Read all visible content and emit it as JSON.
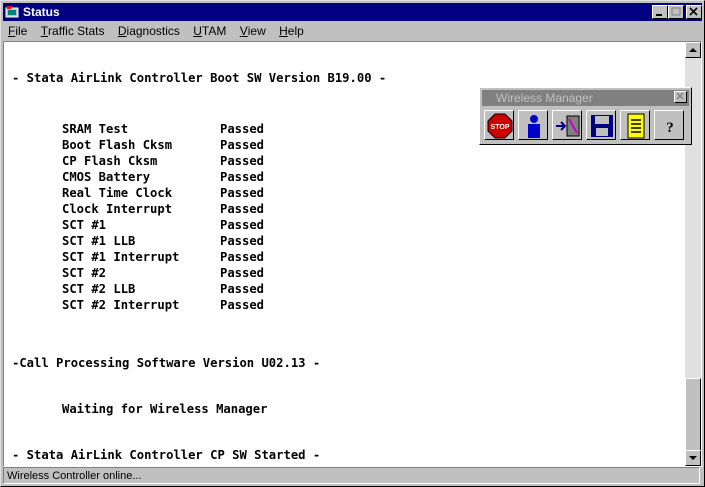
{
  "window": {
    "title": "Status"
  },
  "menu": [
    {
      "label": "File",
      "underline": "F",
      "rest": "ile"
    },
    {
      "label": "Traffic Stats",
      "underline": "T",
      "rest": "raffic Stats"
    },
    {
      "label": "Diagnostics",
      "underline": "D",
      "rest": "iagnostics"
    },
    {
      "label": "UTAM",
      "underline": "U",
      "rest": "TAM"
    },
    {
      "label": "View",
      "underline": "V",
      "rest": "iew"
    },
    {
      "label": "Help",
      "underline": "H",
      "rest": "elp"
    }
  ],
  "console": {
    "boot_header": "- Stata AirLink Controller Boot SW Version B19.00 -",
    "tests": [
      {
        "name": "SRAM Test",
        "result": "Passed"
      },
      {
        "name": "Boot Flash Cksm",
        "result": "Passed"
      },
      {
        "name": "CP Flash Cksm",
        "result": "Passed"
      },
      {
        "name": "CMOS Battery",
        "result": "Passed"
      },
      {
        "name": "Real Time Clock",
        "result": "Passed"
      },
      {
        "name": "Clock Interrupt",
        "result": "Passed"
      },
      {
        "name": "SCT #1",
        "result": "Passed"
      },
      {
        "name": "SCT #1 LLB",
        "result": "Passed"
      },
      {
        "name": "SCT #1 Interrupt",
        "result": "Passed"
      },
      {
        "name": "SCT #2",
        "result": "Passed"
      },
      {
        "name": "SCT #2 LLB",
        "result": "Passed"
      },
      {
        "name": "SCT #2 Interrupt",
        "result": "Passed"
      }
    ],
    "cp_version": "-Call Processing Software Version U02.13 -",
    "waiting": "Waiting for Wireless Manager",
    "started": "- Stata AirLink Controller CP SW Started -"
  },
  "status_bar": {
    "text": "Wireless Controller online..."
  },
  "wireless_manager": {
    "title": "Wireless Manager",
    "buttons": [
      "stop-icon",
      "user-login-icon",
      "connect-icon",
      "save-disk-icon",
      "notepad-icon",
      "help-icon"
    ]
  }
}
